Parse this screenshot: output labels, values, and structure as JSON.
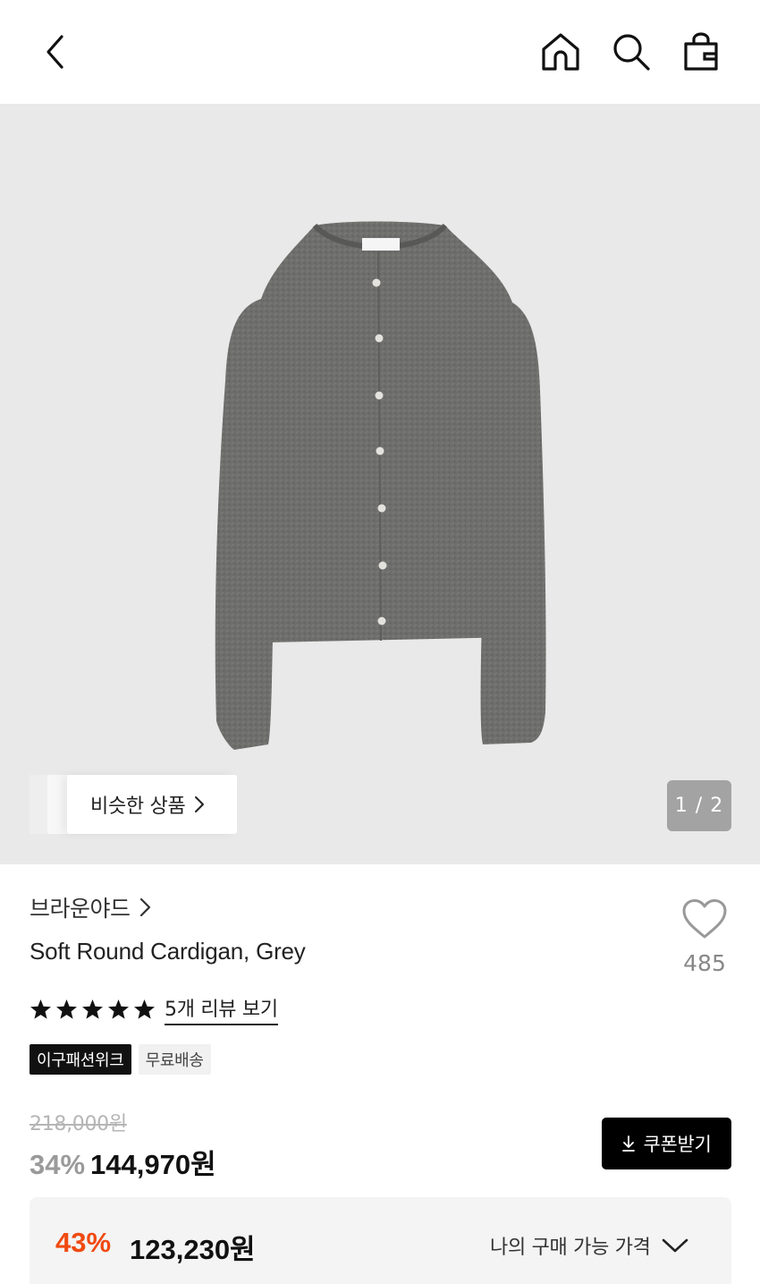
{
  "header": {
    "icons": [
      "back-icon",
      "home-icon",
      "search-icon",
      "shopping-bag-icon"
    ]
  },
  "gallery": {
    "similar_label": "비슷한 상품",
    "page_counter": "1 / 2",
    "current_page": 1,
    "total_pages": 2,
    "background_color": "#e9e9e9"
  },
  "product": {
    "brand": "브라운야드",
    "title": "Soft Round Cardigan, Grey",
    "rating_stars": 5,
    "review_link": "5개 리뷰 보기",
    "like_count": "485",
    "badges": [
      "이구패션위크",
      "무료배송"
    ]
  },
  "pricing": {
    "original_price": "218,000원",
    "discount_percent": "34%",
    "sale_price": "144,970원",
    "coupon_button": "쿠폰받기",
    "my_discount_percent": "43%",
    "my_price": "123,230원",
    "my_price_label": "나의 구매 가능 가격"
  },
  "colors": {
    "accent_discount": "#f04a12",
    "muted_discount": "#9a9a9a",
    "primary": "#111111"
  }
}
